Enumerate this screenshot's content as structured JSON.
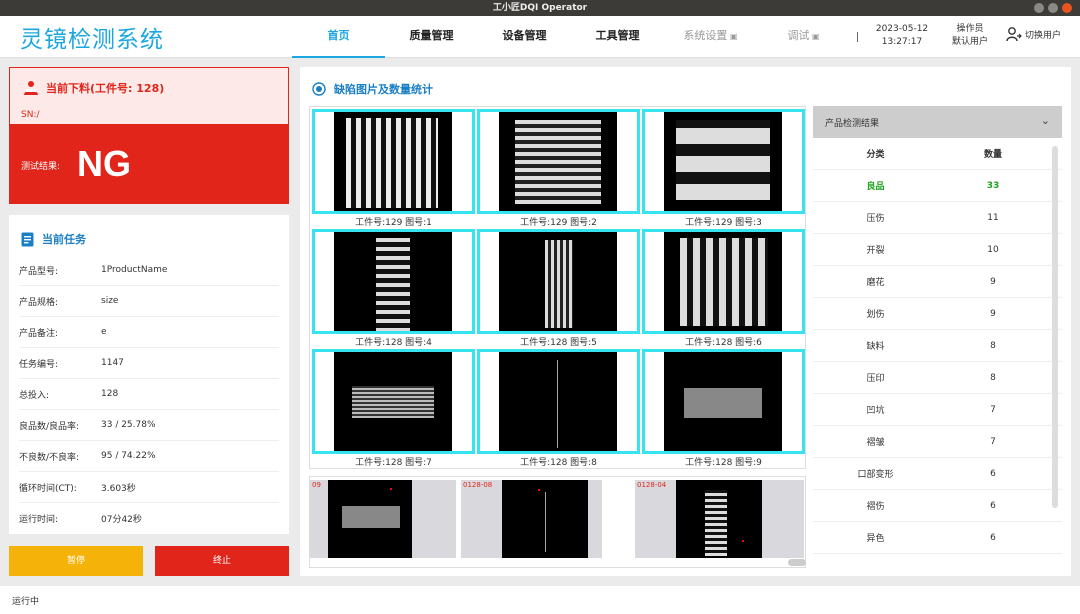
{
  "window": {
    "title": "工小匠DQI Operator"
  },
  "header": {
    "brand": "灵镜检测系统",
    "nav": [
      {
        "label": "首页",
        "active": true,
        "locked": false
      },
      {
        "label": "质量管理",
        "active": false,
        "locked": false
      },
      {
        "label": "设备管理",
        "active": false,
        "locked": false
      },
      {
        "label": "工具管理",
        "active": false,
        "locked": false
      },
      {
        "label": "系统设置",
        "active": false,
        "locked": true
      },
      {
        "label": "调试",
        "active": false,
        "locked": true
      }
    ],
    "date": "2023-05-12",
    "time": "13:27:17",
    "operator_label": "操作员",
    "operator_name": "默认用户",
    "switch_user": "切换用户"
  },
  "status": {
    "title": "当前下料(工件号: 128)",
    "sn": "SN:/",
    "result_label": "测试结果:",
    "result_value": "NG",
    "color": "#e1251b"
  },
  "task": {
    "title": "当前任务",
    "rows": [
      {
        "key": "产品型号:",
        "value": "1ProductName"
      },
      {
        "key": "产品规格:",
        "value": "size"
      },
      {
        "key": "产品备注:",
        "value": "e"
      },
      {
        "key": "任务编号:",
        "value": "1147"
      },
      {
        "key": "总投入:",
        "value": "128"
      },
      {
        "key": "良品数/良品率:",
        "value": "33 / 25.78%"
      },
      {
        "key": "不良数/不良率:",
        "value": "95 / 74.22%"
      },
      {
        "key": "循环时间(CT):",
        "value": "3.603秒"
      },
      {
        "key": "运行时间:",
        "value": "07分42秒"
      }
    ]
  },
  "buttons": {
    "pause": "暂停",
    "stop": "终止"
  },
  "main": {
    "title": "缺陷图片及数量统计",
    "grid": [
      {
        "caption": "工件号:129  图号:1"
      },
      {
        "caption": "工件号:129  图号:2"
      },
      {
        "caption": "工件号:129  图号:3"
      },
      {
        "caption": "工件号:128  图号:4"
      },
      {
        "caption": "工件号:128  图号:5"
      },
      {
        "caption": "工件号:128  图号:6"
      },
      {
        "caption": "工件号:128  图号:7"
      },
      {
        "caption": "工件号:128  图号:8"
      },
      {
        "caption": "工件号:128  图号:9"
      }
    ],
    "thumbs": [
      {
        "label": "09"
      },
      {
        "label": "0128-08"
      },
      {
        "label": "0128-04"
      }
    ]
  },
  "stats": {
    "header": "产品检测结果",
    "col_category": "分类",
    "col_count": "数量",
    "rows": [
      {
        "category": "良品",
        "count": "33",
        "good": true
      },
      {
        "category": "压伤",
        "count": "11",
        "good": false
      },
      {
        "category": "开裂",
        "count": "10",
        "good": false
      },
      {
        "category": "磨花",
        "count": "9",
        "good": false
      },
      {
        "category": "划伤",
        "count": "9",
        "good": false
      },
      {
        "category": "缺料",
        "count": "8",
        "good": false
      },
      {
        "category": "压印",
        "count": "8",
        "good": false
      },
      {
        "category": "凹坑",
        "count": "7",
        "good": false
      },
      {
        "category": "褶皱",
        "count": "7",
        "good": false
      },
      {
        "category": "口部变形",
        "count": "6",
        "good": false
      },
      {
        "category": "褶伤",
        "count": "6",
        "good": false
      },
      {
        "category": "异色",
        "count": "6",
        "good": false
      }
    ]
  },
  "statusbar": {
    "text": "运行中"
  }
}
